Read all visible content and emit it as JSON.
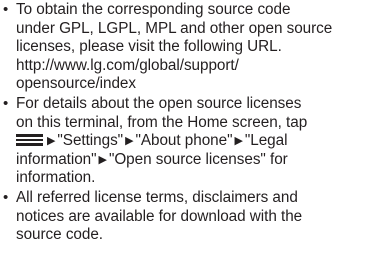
{
  "document": {
    "bullet_glyph": "•",
    "arrow_glyph": "▶",
    "items": [
      {
        "lines": [
          "To obtain the corresponding source code",
          "under GPL, LGPL, MPL and other open source",
          "licenses, please visit the following URL.",
          "http://www.lg.com/global/support/",
          "opensource/index"
        ]
      },
      {
        "lines": [
          "For details about the open source licenses",
          "on this terminal, from the Home screen, tap"
        ],
        "line3": {
          "icon": "menu-icon",
          "part1": "\"Settings\"",
          "part2": "\"About phone\"",
          "part3": "\"Legal"
        },
        "line4": {
          "part1": "information\"",
          "part2": "\"Open source licenses\" for"
        },
        "line5": "information."
      },
      {
        "lines": [
          "All referred license terms, disclaimers and",
          "notices are available for download with the",
          "source code."
        ]
      }
    ]
  }
}
